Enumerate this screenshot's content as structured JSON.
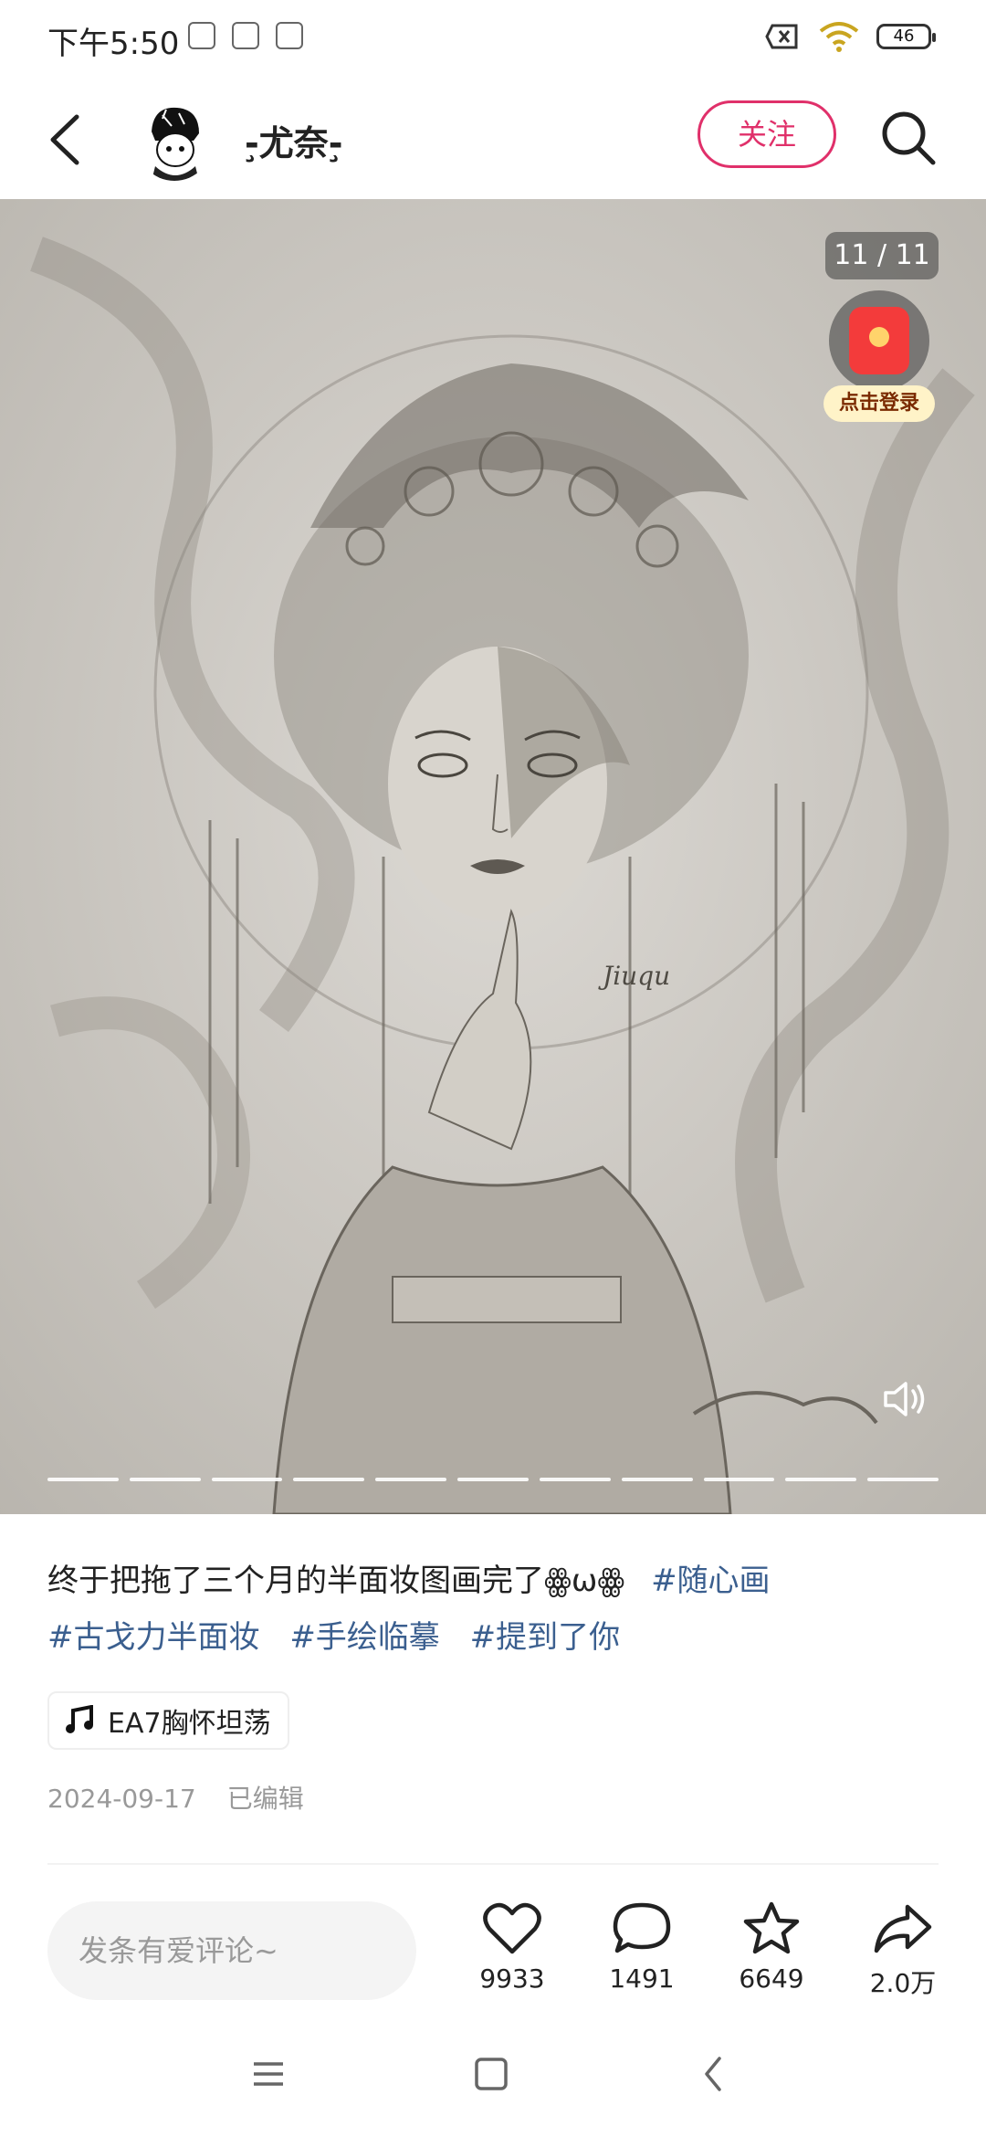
{
  "status_bar": {
    "time": "下午5:50",
    "battery_level": "46"
  },
  "header": {
    "username": "-̧尤奈-̧",
    "follow_label": "关注"
  },
  "media": {
    "page_counter": "11 / 11",
    "login_promo_label": "点击登录",
    "total_pages": 11,
    "current_page": 11,
    "signature": "Jiuqu"
  },
  "caption": {
    "text": "终于把拖了三个月的半面妆图画完了ꙮωꙮ",
    "hashtags": [
      "#随心画",
      "#古戈力半面妆",
      "#手绘临摹",
      "#提到了你"
    ]
  },
  "music": {
    "title": "EA7胸怀坦荡"
  },
  "meta": {
    "date": "2024-09-17",
    "edited_label": "已编辑"
  },
  "bottom_bar": {
    "comment_placeholder": "发条有爱评论~",
    "likes": "9933",
    "comments": "1491",
    "favorites": "6649",
    "shares": "2.0万"
  },
  "colors": {
    "accent": "#e0306a",
    "hashtag": "#3b5f8f"
  }
}
